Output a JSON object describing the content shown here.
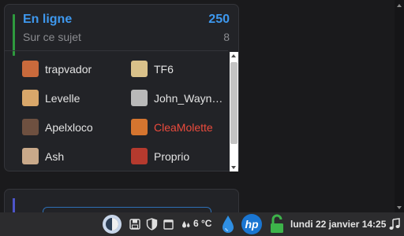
{
  "online_panel": {
    "title": "En ligne",
    "count": "250",
    "topic_label": "Sur ce sujet",
    "topic_count": "8"
  },
  "users": [
    {
      "name": "trapvador",
      "color": "#e3e3e3"
    },
    {
      "name": "TF6",
      "color": "#e3e3e3"
    },
    {
      "name": "Levelle",
      "color": "#e3e3e3"
    },
    {
      "name": "John_Wayn…",
      "color": "#e3e3e3"
    },
    {
      "name": "Apelxloco",
      "color": "#e3e3e3"
    },
    {
      "name": "CleaMolette",
      "color": "#ec4b3d"
    },
    {
      "name": "Ash",
      "color": "#e3e3e3"
    },
    {
      "name": "Proprio",
      "color": "#e3e3e3"
    }
  ],
  "taskbar": {
    "weather": "6 °C",
    "clock": "lundi 22 janvier 14:25",
    "icons": [
      "sun-moon-icon",
      "save-icon",
      "shield-icon",
      "window-icon",
      "drops-icon",
      "hp-icon",
      "lock-icon",
      "music-note-icon"
    ]
  },
  "colors": {
    "accent_blue": "#3e98ee",
    "accent_green": "#2e9a3e",
    "moderator_red": "#ec4b3d"
  }
}
